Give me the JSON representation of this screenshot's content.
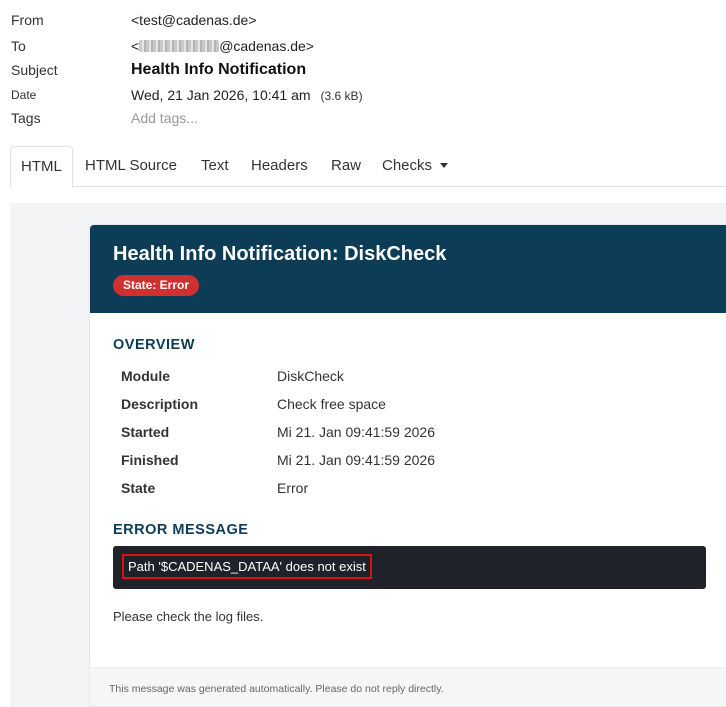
{
  "headers": {
    "from_label": "From",
    "from_value": "<test@cadenas.de>",
    "to_label": "To",
    "to_prefix": "<",
    "to_suffix": "@cadenas.de>",
    "subject_label": "Subject",
    "subject_value": "Health Info Notification",
    "date_label": "Date",
    "date_value": "Wed, 21 Jan 2026, 10:41 am",
    "size_value": "(3.6 kB)",
    "tags_label": "Tags",
    "tags_placeholder": "Add tags..."
  },
  "tabs": [
    {
      "label": "HTML",
      "active": true
    },
    {
      "label": "HTML Source"
    },
    {
      "label": "Text"
    },
    {
      "label": "Headers"
    },
    {
      "label": "Raw"
    },
    {
      "label": "Checks"
    }
  ],
  "email": {
    "title": "Health Info Notification: DiskCheck",
    "state_badge": "State: Error",
    "overview_title": "OVERVIEW",
    "overview": [
      {
        "label": "Module",
        "value": "DiskCheck"
      },
      {
        "label": "Description",
        "value": "Check free space"
      },
      {
        "label": "Started",
        "value": "Mi 21. Jan 09:41:59 2026"
      },
      {
        "label": "Finished",
        "value": "Mi 21. Jan 09:41:59 2026"
      },
      {
        "label": "State",
        "value": "Error"
      }
    ],
    "error_title": "ERROR MESSAGE",
    "error_message": "Path '$CADENAS_DATAA' does not exist",
    "note": "Please check the log files.",
    "footer": "This message was generated automatically. Please do not reply directly."
  },
  "colors": {
    "header_bg": "#0c3c56",
    "badge_error": "#d0302f",
    "error_box_bg": "#1f2329",
    "highlight_border": "#e01010"
  }
}
